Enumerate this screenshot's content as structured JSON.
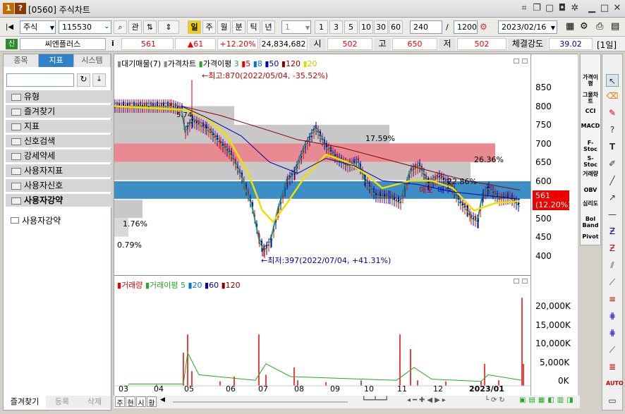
{
  "window": {
    "title": "[0560] 주식차트",
    "icon_l": "1",
    "icon_q": "?"
  },
  "toolbar": {
    "market": "주식",
    "code": "115530",
    "btn_kwan": "관",
    "periods": [
      "일",
      "주",
      "월",
      "분",
      "틱",
      "년"
    ],
    "period_num": "1",
    "nums": [
      "1",
      "3",
      "5",
      "10",
      "30",
      "60"
    ],
    "count": "240",
    "total": "1200",
    "date": "2023/02/16"
  },
  "info": {
    "badge": "신",
    "name": "씨엔플러스",
    "price": "561",
    "change": "▲61",
    "pct": "+12.20%",
    "volume": "24,834,682",
    "open_lbl": "시",
    "open": "502",
    "high_lbl": "고",
    "high": "650",
    "low_lbl": "저",
    "low": "502",
    "strength_lbl": "체결강도",
    "strength": "39.02",
    "unit": "[1일]"
  },
  "left": {
    "tabs": [
      "종목",
      "지표",
      "시스템"
    ],
    "folders": [
      "유형",
      "즐겨찾기",
      "지표",
      "신호검색",
      "강세약세",
      "사용자지표",
      "사용자신호",
      "사용자강약"
    ],
    "sub": "사용자강약",
    "bottom_tabs": [
      "즐겨찾기",
      "등록",
      "삭제"
    ]
  },
  "price_legend": {
    "l1": "대기매물(7)",
    "l2": "가격차트",
    "l3": "가격이평",
    "n": [
      "3",
      "5",
      "8",
      "50",
      "120",
      "20"
    ]
  },
  "annot": {
    "high": "최고:870(2022/05/04, -35.52%)",
    "low": "최저:397(2022/07/04, +41.31%)",
    "p1": "17.59%",
    "p2": "26.36%",
    "p3": "22.86%",
    "p4": "1.76%",
    "p5": "0.79%",
    "n5": "5.74",
    "sell": "매도",
    "buy": "매수"
  },
  "yaxis": {
    "labels": [
      "850",
      "800",
      "750",
      "700",
      "650",
      "600",
      "550",
      "500",
      "450",
      "400"
    ],
    "cur": "561",
    "cur_pct": "(12.20%)"
  },
  "vol_legend": {
    "l1": "거래량",
    "l2": "거래이평",
    "n": [
      "5",
      "20",
      "60",
      "120"
    ]
  },
  "vaxis": {
    "labels": [
      "20,000K",
      "15,000K",
      "10,000K",
      "5,000K",
      "0K"
    ]
  },
  "xaxis": [
    "03",
    "04",
    "05",
    "06",
    "07",
    "08",
    "09",
    "10",
    "11",
    "12",
    "2023/01"
  ],
  "right_btns": [
    "가격이평",
    "그물차트",
    "CCI",
    "MACD",
    "F-Stoc",
    "S-Stoc",
    "거래량",
    "OBV",
    "심리도",
    "Bol Band",
    "Pivot"
  ],
  "bottom_tabs": [
    "주",
    "현",
    "시",
    "황"
  ],
  "colors": {
    "band_gray": "#c8c8c8",
    "band_red": "#e88a92",
    "band_blue": "#3d8ec4",
    "ma_yellow": "#f0e000"
  }
}
